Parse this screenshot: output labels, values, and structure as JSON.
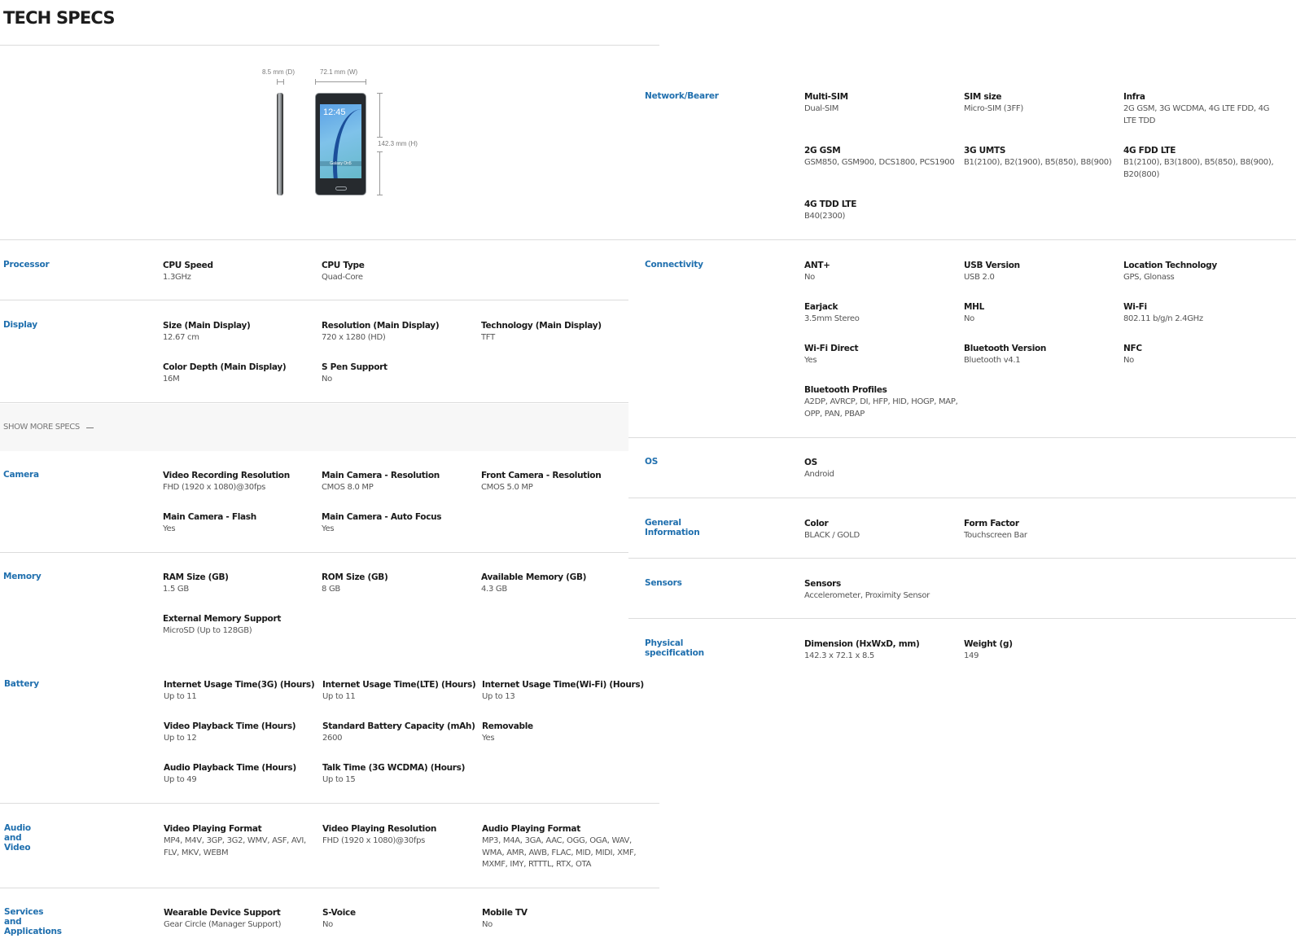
{
  "page": {
    "title": "TECH SPECS",
    "show_more_label": "SHOW MORE SPECS",
    "show_more_icon": "minus-icon"
  },
  "colors": {
    "category_label": "#1f6fae",
    "spec_label": "#1a1a1a",
    "spec_value": "#555555",
    "divider": "#dcdcdc",
    "show_more_bg": "#f7f7f7"
  },
  "figure": {
    "depth_label": "8.5 mm (D)",
    "width_label": "72.1 mm (W)",
    "height_label": "142.3 mm (H)",
    "screen_clock": "12:45",
    "screen_brand": "Galaxy On5",
    "image": "phone-front-and-side-image"
  },
  "left_sections": [
    {
      "category": "Processor",
      "specs": [
        {
          "label": "CPU Speed",
          "value": "1.3GHz"
        },
        {
          "label": "CPU Type",
          "value": "Quad-Core"
        }
      ]
    },
    {
      "category": "Display",
      "specs": [
        {
          "label": "Size (Main Display)",
          "value": "12.67 cm"
        },
        {
          "label": "Resolution (Main Display)",
          "value": "720 x 1280 (HD)"
        },
        {
          "label": "Technology (Main Display)",
          "value": "TFT"
        },
        {
          "label": "Color Depth (Main Display)",
          "value": "16M"
        },
        {
          "label": "S Pen Support",
          "value": "No"
        }
      ]
    },
    {
      "category": "Camera",
      "specs": [
        {
          "label": "Video Recording Resolution",
          "value": "FHD (1920 x 1080)@30fps"
        },
        {
          "label": "Main Camera - Resolution",
          "value": "CMOS 8.0 MP"
        },
        {
          "label": "Front Camera - Resolution",
          "value": "CMOS 5.0 MP"
        },
        {
          "label": "Main Camera - Flash",
          "value": "Yes"
        },
        {
          "label": "Main Camera - Auto Focus",
          "value": "Yes"
        }
      ]
    },
    {
      "category": "Memory",
      "specs": [
        {
          "label": "RAM Size (GB)",
          "value": "1.5 GB"
        },
        {
          "label": "ROM Size (GB)",
          "value": "8 GB"
        },
        {
          "label": "Available Memory (GB)",
          "value": "4.3 GB"
        },
        {
          "label": "External Memory Support",
          "value": "MicroSD (Up to 128GB)"
        }
      ]
    },
    {
      "category": "Battery",
      "specs": [
        {
          "label": "Internet Usage Time(3G) (Hours)",
          "value": "Up to 11"
        },
        {
          "label": "Internet Usage Time(LTE) (Hours)",
          "value": "Up to 11"
        },
        {
          "label": "Internet Usage Time(Wi-Fi) (Hours)",
          "value": "Up to 13"
        },
        {
          "label": "Video Playback Time (Hours)",
          "value": "Up to 12"
        },
        {
          "label": "Standard Battery Capacity (mAh)",
          "value": "2600"
        },
        {
          "label": "Removable",
          "value": "Yes"
        },
        {
          "label": "Audio Playback Time (Hours)",
          "value": "Up to 49"
        },
        {
          "label": "Talk Time (3G WCDMA) (Hours)",
          "value": "Up to 15"
        }
      ]
    },
    {
      "category": "Audio and Video",
      "specs": [
        {
          "label": "Video Playing Format",
          "value": "MP4, M4V, 3GP, 3G2, WMV, ASF, AVI, FLV, MKV, WEBM"
        },
        {
          "label": "Video Playing Resolution",
          "value": "FHD (1920 x 1080)@30fps"
        },
        {
          "label": "Audio Playing Format",
          "value": "MP3, M4A, 3GA, AAC, OGG, OGA, WAV, WMA, AMR, AWB, FLAC, MID, MIDI, XMF, MXMF, IMY, RTTTL, RTX, OTA"
        }
      ]
    },
    {
      "category": "Services and Applications",
      "specs": [
        {
          "label": "Wearable Device Support",
          "value": "Gear Circle (Manager Support)"
        },
        {
          "label": "S-Voice",
          "value": "No"
        },
        {
          "label": "Mobile TV",
          "value": "No"
        }
      ]
    }
  ],
  "right_sections": [
    {
      "category": "Network/Bearer",
      "specs": [
        {
          "label": "Multi-SIM",
          "value": "Dual-SIM"
        },
        {
          "label": "SIM size",
          "value": "Micro-SIM (3FF)"
        },
        {
          "label": "Infra",
          "value": "2G GSM, 3G WCDMA, 4G LTE FDD, 4G LTE TDD"
        },
        {
          "label": "2G GSM",
          "value": "GSM850, GSM900, DCS1800, PCS1900"
        },
        {
          "label": "3G UMTS",
          "value": "B1(2100), B2(1900), B5(850), B8(900)"
        },
        {
          "label": "4G FDD LTE",
          "value": "B1(2100), B3(1800), B5(850), B8(900), B20(800)"
        },
        {
          "label": "4G TDD LTE",
          "value": "B40(2300)"
        }
      ]
    },
    {
      "category": "Connectivity",
      "specs": [
        {
          "label": "ANT+",
          "value": "No"
        },
        {
          "label": "USB Version",
          "value": "USB 2.0"
        },
        {
          "label": "Location Technology",
          "value": "GPS, Glonass"
        },
        {
          "label": "Earjack",
          "value": "3.5mm Stereo"
        },
        {
          "label": "MHL",
          "value": "No"
        },
        {
          "label": "Wi-Fi",
          "value": "802.11 b/g/n 2.4GHz"
        },
        {
          "label": "Wi-Fi Direct",
          "value": "Yes"
        },
        {
          "label": "Bluetooth Version",
          "value": "Bluetooth v4.1"
        },
        {
          "label": "NFC",
          "value": "No"
        },
        {
          "label": "Bluetooth Profiles",
          "value": "A2DP, AVRCP, DI, HFP, HID, HOGP, MAP, OPP, PAN, PBAP"
        }
      ]
    },
    {
      "category": "OS",
      "specs": [
        {
          "label": "OS",
          "value": "Android"
        }
      ]
    },
    {
      "category": "General Information",
      "specs": [
        {
          "label": "Color",
          "value": "BLACK / GOLD"
        },
        {
          "label": "Form Factor",
          "value": "Touchscreen Bar"
        }
      ]
    },
    {
      "category": "Sensors",
      "specs": [
        {
          "label": "Sensors",
          "value": "Accelerometer, Proximity Sensor"
        }
      ]
    },
    {
      "category": "Physical specification",
      "specs": [
        {
          "label": "Dimension (HxWxD, mm)",
          "value": "142.3 x 72.1 x 8.5"
        },
        {
          "label": "Weight (g)",
          "value": "149"
        }
      ]
    }
  ]
}
